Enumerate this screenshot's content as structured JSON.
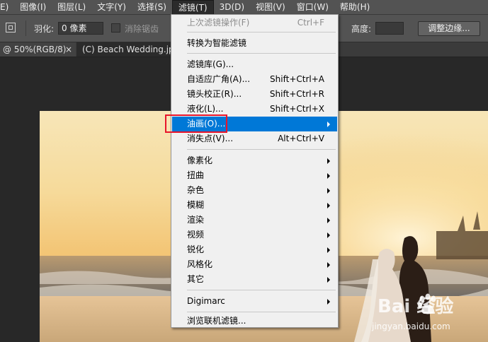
{
  "menubar": {
    "items": [
      "E)",
      "图像(I)",
      "图层(L)",
      "文字(Y)",
      "选择(S)",
      "滤镜(T)",
      "3D(D)",
      "视图(V)",
      "窗口(W)",
      "帮助(H)"
    ],
    "active_index": 5
  },
  "options": {
    "feather_label": "羽化:",
    "feather_value": "0 像素",
    "antialias_label": "消除锯齿",
    "height_label": "高度:",
    "refine_edge_label": "调整边缘..."
  },
  "tabs": {
    "tab1_label": "@ 50%(RGB/8)",
    "tab1_close": "×",
    "tab2_label": "(C) Beach Wedding.jpg @"
  },
  "filter_menu": {
    "last_filter": {
      "label": "上次滤镜操作(F)",
      "shortcut": "Ctrl+F"
    },
    "convert_smart": {
      "label": "转换为智能滤镜"
    },
    "filter_gallery": {
      "label": "滤镜库(G)..."
    },
    "adaptive_wide": {
      "label": "自适应广角(A)...",
      "shortcut": "Shift+Ctrl+A"
    },
    "lens_correction": {
      "label": "镜头校正(R)...",
      "shortcut": "Shift+Ctrl+R"
    },
    "liquify": {
      "label": "液化(L)...",
      "shortcut": "Shift+Ctrl+X"
    },
    "oil_paint": {
      "label": "油画(O)..."
    },
    "vanishing_point": {
      "label": "消失点(V)...",
      "shortcut": "Alt+Ctrl+V"
    },
    "pixelate": {
      "label": "像素化"
    },
    "distort": {
      "label": "扭曲"
    },
    "noise": {
      "label": "杂色"
    },
    "blur": {
      "label": "模糊"
    },
    "render": {
      "label": "渲染"
    },
    "video": {
      "label": "视频"
    },
    "sharpen": {
      "label": "锐化"
    },
    "stylize": {
      "label": "风格化"
    },
    "other": {
      "label": "其它"
    },
    "digimarc": {
      "label": "Digimarc"
    },
    "browse_online": {
      "label": "浏览联机滤镜..."
    }
  },
  "watermark": {
    "brand": "Bai  经验",
    "url": "jingyan.baidu.com"
  },
  "colors": {
    "highlight": "#0078d7",
    "annotation_box": "#e8152b"
  }
}
